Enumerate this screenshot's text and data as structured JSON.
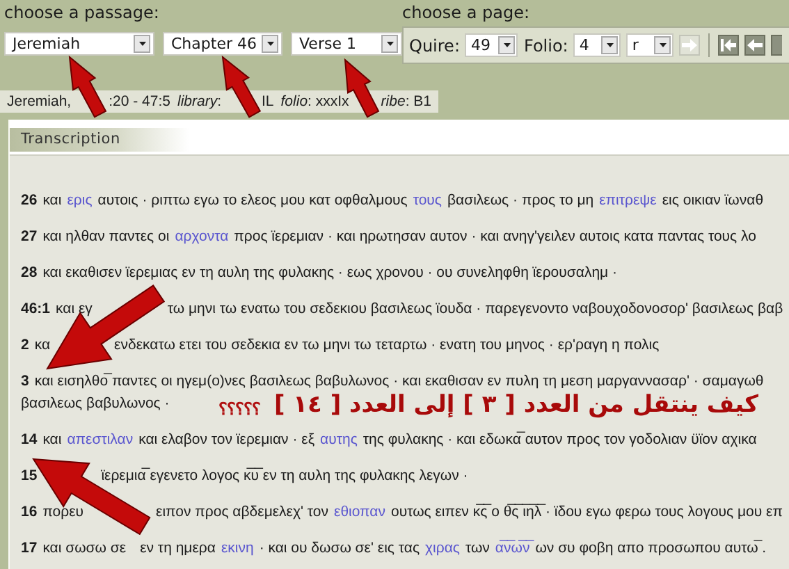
{
  "passage": {
    "label": "choose a passage:",
    "selects": [
      {
        "value": "Jeremiah"
      },
      {
        "value": "Chapter 46"
      },
      {
        "value": "Verse 1"
      }
    ]
  },
  "page": {
    "label": "choose a page:",
    "fields": [
      {
        "label": "Quire:",
        "value": "49"
      },
      {
        "label": "Folio:",
        "value": "4"
      },
      {
        "value": "r"
      }
    ],
    "go_disabled": true
  },
  "info": [
    {
      "kind": "text",
      "text": "Jeremiah,"
    },
    {
      "kind": "nick"
    },
    {
      "kind": "text",
      "text": ":20 - 47:5"
    },
    {
      "kind": "label",
      "text": "library"
    },
    {
      "kind": "text",
      "text": ":"
    },
    {
      "kind": "nick"
    },
    {
      "kind": "text",
      "text": "IL"
    },
    {
      "kind": "label",
      "text": "folio"
    },
    {
      "kind": "text",
      "text": ": xxxIx"
    },
    {
      "kind": "nick"
    },
    {
      "kind": "label",
      "text": "ribe"
    },
    {
      "kind": "text",
      "text": ": B1"
    }
  ],
  "panel": {
    "tab": "Transcription",
    "verses": [
      {
        "number": "26",
        "lines": [
          [
            {
              "kind": "text",
              "text": "και"
            },
            {
              "kind": "variant",
              "text": "ερις"
            },
            {
              "kind": "text",
              "text": "αυτοις · ριπτω εγω το ελεος μου κατ οφθαλμους"
            },
            {
              "kind": "variant",
              "text": "τους"
            },
            {
              "kind": "text",
              "text": "βασιλεως · προς το μη"
            },
            {
              "kind": "variant",
              "text": "επιτρεψε"
            },
            {
              "kind": "text",
              "text": "εις οικιαν ϊωναθ"
            }
          ]
        ]
      },
      {
        "number": "27",
        "lines": [
          [
            {
              "kind": "text",
              "text": "και ηλθαν παντες οι"
            },
            {
              "kind": "variant",
              "text": "αρχοντα"
            },
            {
              "kind": "text",
              "text": "προς ϊερεμιαν · και ηρωτησαν αυτον · και ανηγ'γειλεν αυτοις κατα παντας τους λο"
            }
          ]
        ]
      },
      {
        "number": "28",
        "lines": [
          [
            {
              "kind": "text",
              "text": "και εκαθισεν ϊερεμιας εν τη αυλη της φυλακης · εως χρονου · ου συνεληφθη ϊερουσαλημ ·"
            }
          ]
        ]
      },
      {
        "number": "46:1",
        "lines": [
          [
            {
              "kind": "text",
              "text": "και εγ"
            },
            {
              "kind": "gap"
            },
            {
              "kind": "text",
              "text": "τω μηνι τω ενατω του σεδεκιου βασιλεως ϊουδα · παρεγενοντο ναβουχοδονοσορ' βασιλεως βαβ"
            }
          ]
        ]
      },
      {
        "number": "2",
        "lines": [
          [
            {
              "kind": "text",
              "text": "κα"
            },
            {
              "kind": "gap"
            },
            {
              "kind": "text",
              "text": "ενδεκατω ετει του σεδεκια εν τω μηνι τω τεταρτω · ενατη του μηνος · ερ'ραγη η πολις"
            }
          ]
        ]
      },
      {
        "number": "3",
        "lines": [
          [
            {
              "kind": "text",
              "text": "και εισηλθο̅ παντες οι ηγεμ(ο)νες βασιλεως βαβυλωνος · και εκαθισαν εν πυλη τη μεση μαργαννασαρ' · σαμαγωθ"
            }
          ],
          [
            {
              "kind": "text",
              "text": "βασιλεως βαβυλωνος ·"
            }
          ]
        ]
      },
      {
        "number": "14",
        "lines": [
          [
            {
              "kind": "text",
              "text": "και"
            },
            {
              "kind": "variant",
              "text": "απεστιλαν"
            },
            {
              "kind": "text",
              "text": "και ελαβον τον ϊερεμιαν · εξ"
            },
            {
              "kind": "variant",
              "text": "αυτης"
            },
            {
              "kind": "text",
              "text": "της φυλακης · και εδωκα̅ αυτον προς τον γοδολιαν ϋϊον αχικα"
            }
          ]
        ]
      },
      {
        "number": "15",
        "lines": [
          [
            {
              "kind": "gap"
            },
            {
              "kind": "text",
              "text": "ϊερεμια̅ εγενετο λογος κ̅υ̅ εν τη αυλη της φυλακης λεγων ·"
            }
          ]
        ]
      },
      {
        "number": "16",
        "lines": [
          [
            {
              "kind": "text",
              "text": "πορευ"
            },
            {
              "kind": "gap"
            },
            {
              "kind": "text",
              "text": "ειπον προς αβδεμελεχ' τον"
            },
            {
              "kind": "variant",
              "text": "εθιοπαν"
            },
            {
              "kind": "text",
              "text": "ουτως ειπεν κ̅ς̅ ο θ̅ς̅ ι̅η̅λ̅ · ϊδου εγω φερω τους λογους μου επ"
            }
          ]
        ]
      },
      {
        "number": "17",
        "lines": [
          [
            {
              "kind": "text",
              "text": "και σωσω σε"
            },
            {
              "kind": "nick"
            },
            {
              "kind": "text",
              "text": "εν τη ημερα"
            },
            {
              "kind": "variant",
              "text": "εκινη"
            },
            {
              "kind": "text",
              "text": "· και ου δωσω σε' εις τας"
            },
            {
              "kind": "variant",
              "text": "χιρας"
            },
            {
              "kind": "text",
              "text": "των"
            },
            {
              "kind": "variant",
              "text": "α̅ν̅ω̅ν̅"
            },
            {
              "kind": "text",
              "text": "ων συ φοβη απο προσωπου αυτω̅ ."
            }
          ]
        ]
      }
    ]
  },
  "caption": {
    "text": "كيف ينتقل من العدد [ ٣ ] إلى العدد [ ١٤ ]",
    "marks": "؟؟؟؟؟"
  }
}
